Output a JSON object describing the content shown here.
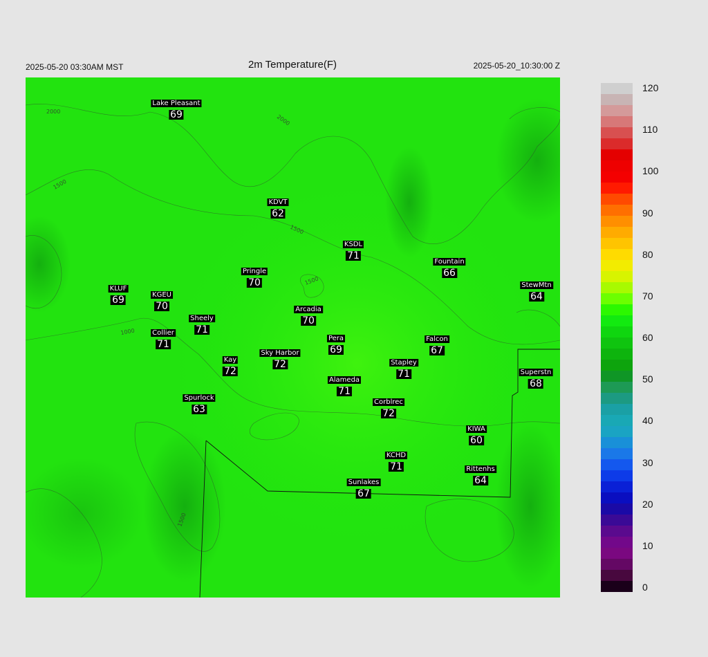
{
  "header": {
    "local_time": "2025-05-20 03:30AM MST",
    "title": "2m Temperature(F)",
    "utc_time": "2025-05-20_10:30:00 Z"
  },
  "colorbar": {
    "labels": [
      "120",
      "110",
      "100",
      "90",
      "80",
      "70",
      "60",
      "50",
      "40",
      "30",
      "20",
      "10",
      "0"
    ],
    "min": 0,
    "max": 120
  },
  "contour_labels": [
    "2000",
    "1500",
    "1000",
    "1500",
    "1500",
    "2000",
    "1500"
  ],
  "stations": [
    {
      "name": "Lake Pleasant",
      "value": "69"
    },
    {
      "name": "KDVT",
      "value": "62"
    },
    {
      "name": "KSDL",
      "value": "71"
    },
    {
      "name": "Fountain",
      "value": "66"
    },
    {
      "name": "StewMtn",
      "value": "64"
    },
    {
      "name": "Pringle",
      "value": "70"
    },
    {
      "name": "KLUF",
      "value": "69"
    },
    {
      "name": "KGEU",
      "value": "70"
    },
    {
      "name": "Arcadia",
      "value": "70"
    },
    {
      "name": "Sheely",
      "value": "71"
    },
    {
      "name": "Collier",
      "value": "71"
    },
    {
      "name": "Pera",
      "value": "69"
    },
    {
      "name": "Falcon",
      "value": "67"
    },
    {
      "name": "Kay",
      "value": "72"
    },
    {
      "name": "Sky Harbor",
      "value": "72"
    },
    {
      "name": "Stapley",
      "value": "71"
    },
    {
      "name": "Superstn",
      "value": "68"
    },
    {
      "name": "Alameda",
      "value": "71"
    },
    {
      "name": "Spurlock",
      "value": "63"
    },
    {
      "name": "Corblrec",
      "value": "72"
    },
    {
      "name": "KIWA",
      "value": "60"
    },
    {
      "name": "KCHD",
      "value": "71"
    },
    {
      "name": "Rittenhs",
      "value": "64"
    },
    {
      "name": "Sunlakes",
      "value": "67"
    }
  ]
}
